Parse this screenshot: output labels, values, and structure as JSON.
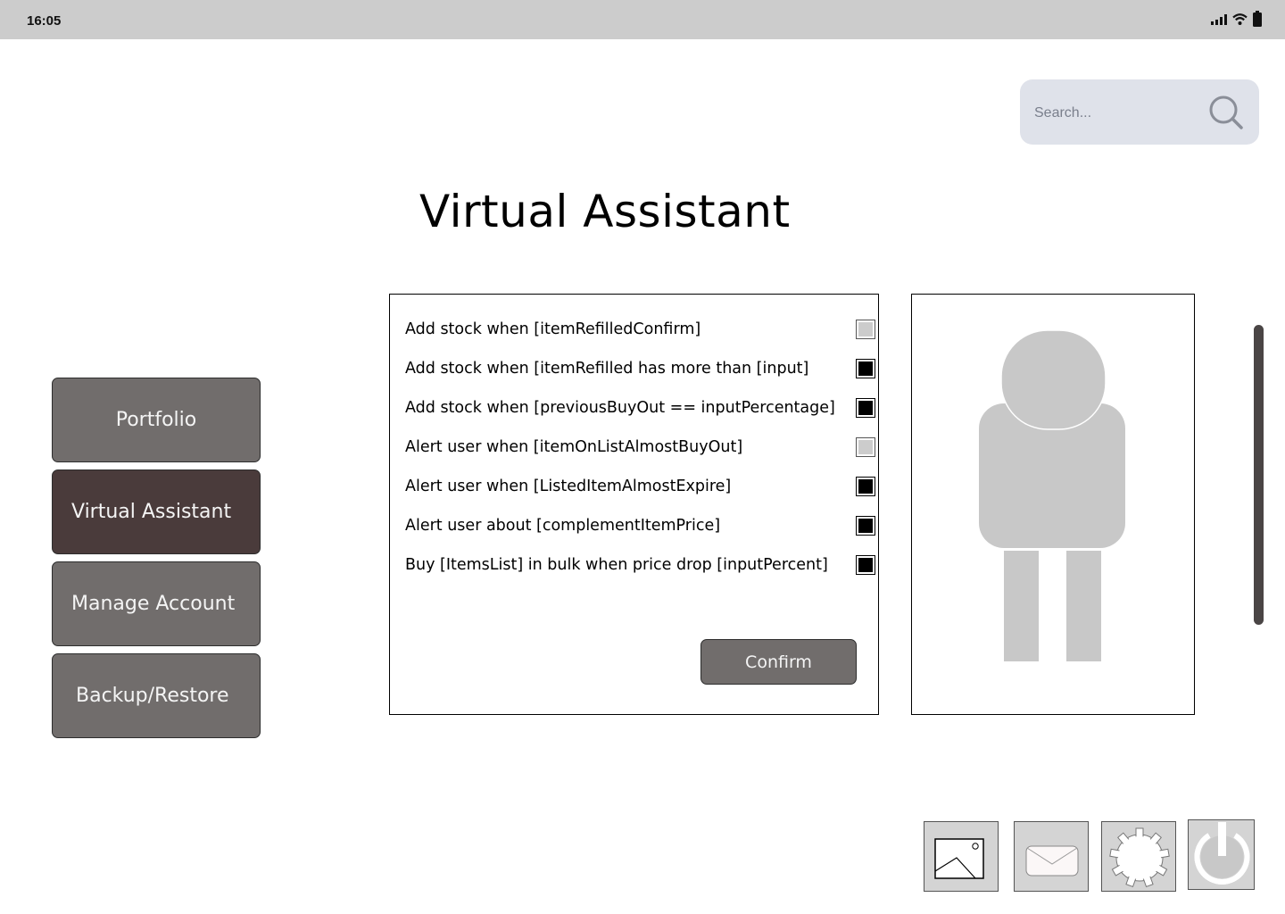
{
  "status_bar": {
    "time": "16:05",
    "icons": [
      "signal-icon",
      "wifi-icon",
      "battery-icon"
    ]
  },
  "search": {
    "placeholder": "Search...",
    "value": "",
    "icon": "search-icon"
  },
  "page": {
    "title": "Virtual Assistant"
  },
  "sidebar": {
    "items": [
      {
        "label": "Portfolio",
        "active": false
      },
      {
        "label": "Virtual Assistant",
        "active": true
      },
      {
        "label": "Manage Account",
        "active": false
      },
      {
        "label": "Backup/Restore",
        "active": false
      }
    ]
  },
  "options": {
    "items": [
      {
        "label": "Add stock when [itemRefilledConfirm]",
        "checked": false
      },
      {
        "label": "Add stock when [itemRefilled has more than  [input]",
        "checked": true
      },
      {
        "label": "Add stock when [previousBuyOut == inputPercentage]",
        "checked": true
      },
      {
        "label": "Alert user when [itemOnListAlmostBuyOut]",
        "checked": false
      },
      {
        "label": "Alert user when [ListedItemAlmostExpire]",
        "checked": true
      },
      {
        "label": "Alert user about [complementItemPrice]",
        "checked": true
      },
      {
        "label": "Buy [ItemsList] in bulk when price drop [inputPercent]",
        "checked": true
      }
    ],
    "confirm_label": "Confirm"
  },
  "avatar": {
    "icon": "person-placeholder-icon"
  },
  "toolbar": {
    "buttons": [
      "image-icon",
      "mail-icon",
      "settings-gear-icon",
      "power-icon"
    ]
  },
  "colors": {
    "status_bar": "#cccccc",
    "search_bg": "#dfe2ea",
    "nav_button": "#716d6c",
    "nav_button_active": "#4a3b3b",
    "avatar_gray": "#c8c8c8",
    "scrollbar": "#4a4545",
    "toolbar_button": "#d4d4d4"
  }
}
